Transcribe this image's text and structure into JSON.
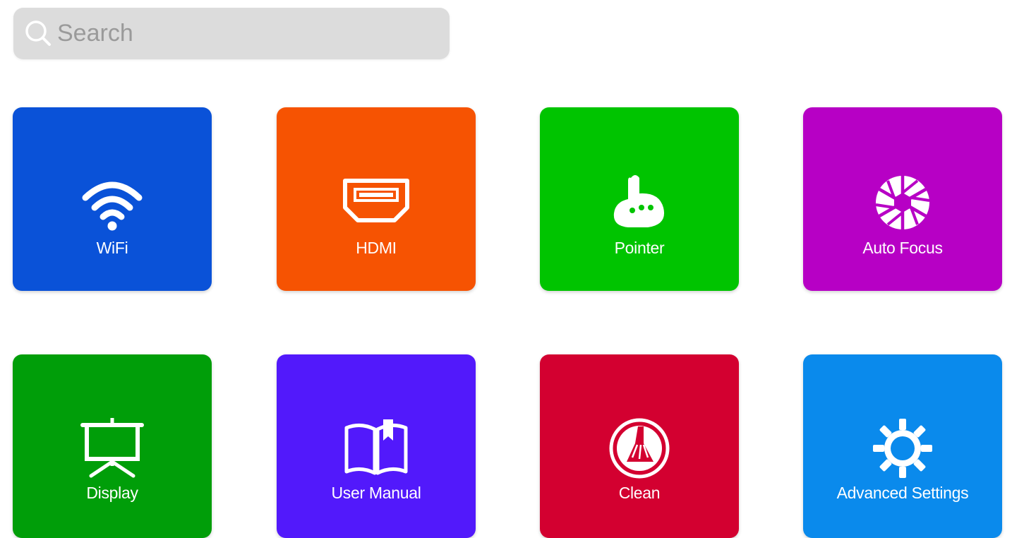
{
  "search": {
    "placeholder": "Search"
  },
  "tiles": [
    {
      "label": "WiFi",
      "icon": "wifi-icon",
      "color": "#0a52d8"
    },
    {
      "label": "HDMI",
      "icon": "hdmi-icon",
      "color": "#f65302"
    },
    {
      "label": "Pointer",
      "icon": "pointer-icon",
      "color": "#00c400"
    },
    {
      "label": "Auto Focus",
      "icon": "aperture-icon",
      "color": "#b700c5"
    },
    {
      "label": "Display",
      "icon": "projector-screen-icon",
      "color": "#009e09"
    },
    {
      "label": "User Manual",
      "icon": "book-icon",
      "color": "#5219fb"
    },
    {
      "label": "Clean",
      "icon": "broom-icon",
      "color": "#d30030"
    },
    {
      "label": "Advanced Settings",
      "icon": "gear-icon",
      "color": "#0a8aec"
    }
  ]
}
